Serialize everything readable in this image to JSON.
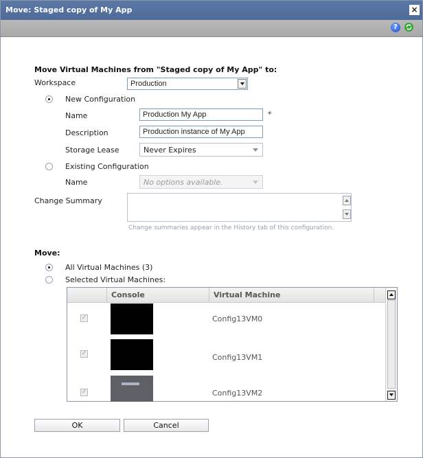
{
  "window": {
    "title": "Move: Staged copy of My App",
    "close_glyph": "×"
  },
  "toolbar": {
    "help_glyph": "?",
    "help_icon": "help-icon",
    "refresh_icon": "refresh-icon"
  },
  "form": {
    "heading": "Move Virtual Machines from \"Staged copy of My App\" to:",
    "workspace": {
      "label": "Workspace",
      "value": "Production"
    },
    "new_configuration": {
      "label": "New Configuration",
      "selected": true,
      "name_label": "Name",
      "name_value": "Production My App",
      "required_mark": "*",
      "description_label": "Description",
      "description_value": "Production instance of  My App",
      "storage_lease_label": "Storage Lease",
      "storage_lease_value": "Never Expires"
    },
    "existing_configuration": {
      "label": "Existing Configuration",
      "selected": false,
      "name_label": "Name",
      "name_value": "No options available."
    },
    "change_summary": {
      "label": "Change Summary",
      "value": "",
      "hint": "Change summaries appear in the History tab of this configuration."
    }
  },
  "move": {
    "heading": "Move:",
    "all_vms_label": "All Virtual Machines (3)",
    "all_vms_selected": true,
    "selected_vms_label": "Selected Virtual Machines:",
    "selected_vms_selected": false,
    "grid": {
      "columns": [
        "Console",
        "Virtual Machine"
      ],
      "rows": [
        {
          "checked": true,
          "console": "black",
          "vm": "Config13VM0"
        },
        {
          "checked": true,
          "console": "black",
          "vm": "Config13VM1"
        },
        {
          "checked": true,
          "console": "gray",
          "vm": "Config13VM2"
        }
      ],
      "check_glyph": "✓"
    }
  },
  "buttons": {
    "ok": "OK",
    "cancel": "Cancel"
  },
  "colors": {
    "titlebar": "#5573a2",
    "toolbar": "#b0b0b0",
    "input_border": "#7f9db9"
  }
}
